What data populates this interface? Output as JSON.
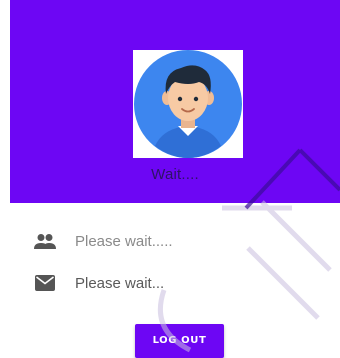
{
  "profile": {
    "status": "Wait....",
    "avatar_icon": "user-avatar-icon"
  },
  "info": {
    "name_icon": "people-icon",
    "name": "Please wait.....",
    "email_icon": "mail-icon",
    "email": "Please wait..."
  },
  "actions": {
    "logout_label": "LOG OUT"
  },
  "colors": {
    "primary": "#6d06f4",
    "avatar_bg": "#3d86ef",
    "icon_gray": "#555555"
  }
}
